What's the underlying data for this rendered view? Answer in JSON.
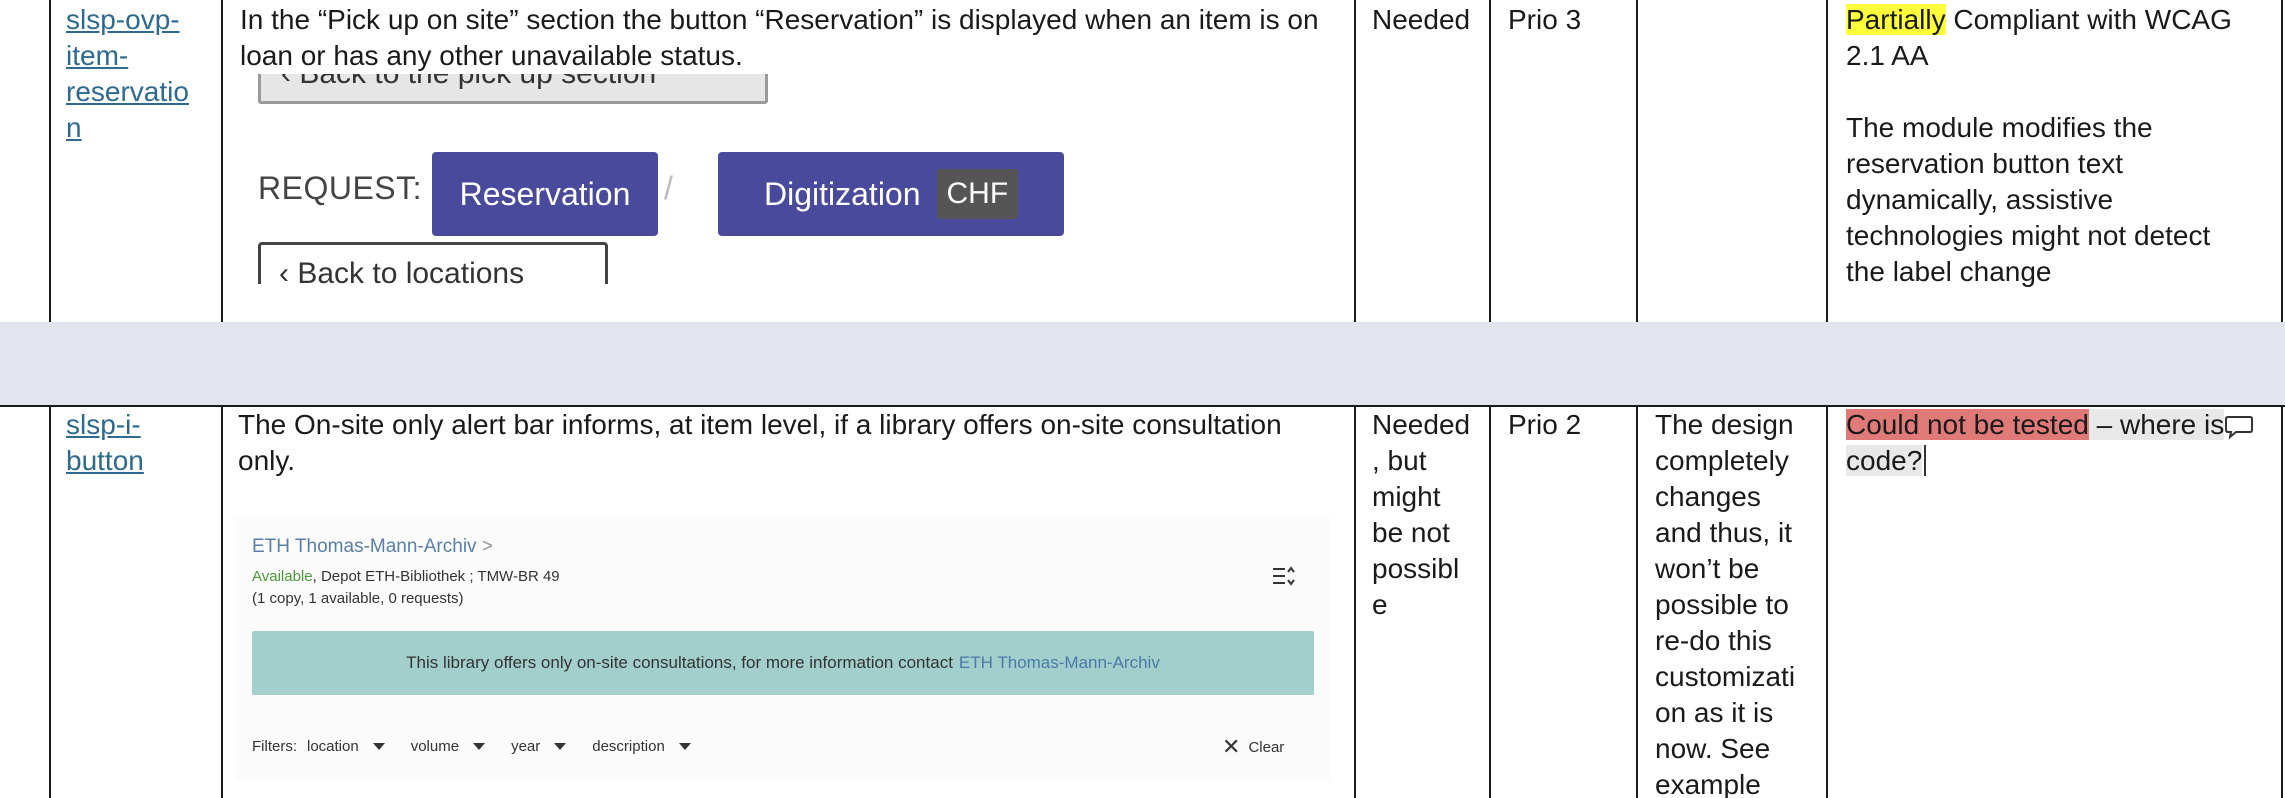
{
  "rows": [
    {
      "id_link": [
        "slsp-ovp-",
        "item-",
        "reservatio",
        "n"
      ],
      "description": [
        "In the “Pick up on site” section the button “Reservation” is displayed when an item is on",
        "loan or has any other unavailable status."
      ],
      "needed": [
        "Needed"
      ],
      "priority": "Prio 3",
      "notes": [],
      "compliance_highlight": "Partially",
      "compliance_rest_line1": " Compliant with WCAG",
      "compliance_line2": "2.1 AA",
      "compliance_detail": [
        "The module modifies the",
        "reservation button text",
        "dynamically, assistive",
        "technologies might not detect",
        "the label change"
      ],
      "screenshot": {
        "back_top_label": "Back to the pick up section",
        "request_label": "REQUEST:",
        "reservation_label": "Reservation",
        "separator": "/",
        "digitization_label": "Digitization",
        "chf_label": "CHF",
        "back_bottom_label": "Back to locations"
      }
    },
    {
      "id_link": [
        "slsp-i-",
        "button"
      ],
      "description": [
        "The On-site only alert bar informs, at item level, if a library offers on-site consultation",
        "only."
      ],
      "needed": [
        "Needed",
        ", but",
        "might",
        "be not",
        "possibl",
        "e"
      ],
      "priority": "Prio 2",
      "notes": [
        "The design",
        "completely",
        "changes",
        "and thus, it",
        "won’t be",
        "possible to",
        "re-do this",
        "customizati",
        "on as it is",
        "now. See",
        "example"
      ],
      "compliance_highlight": "Could not be tested",
      "compliance_rest_line1": " – where is",
      "compliance_line2": "code?",
      "screenshot": {
        "library_link": "ETH Thomas-Mann-Archiv",
        "library_chevron": ">",
        "available_label": "Available",
        "location_text": ", Depot ETH-Bibliothek ; TMW-BR 49",
        "copies_text": "(1 copy, 1 available, 0 requests)",
        "alert_text": "This library offers only on-site consultations, for more information contact",
        "alert_link": "ETH Thomas-Mann-Archiv",
        "filters_label": "Filters:",
        "filter_options": [
          "location",
          "volume",
          "year",
          "description"
        ],
        "clear_label": "Clear"
      }
    }
  ],
  "colors": {
    "link": "#2d6a8f",
    "highlight_yellow": "#ffff3b",
    "highlight_red": "#e07a78",
    "row_gap": "#e2e4f0",
    "button": "#4a4a9c",
    "alert_bar": "#a2cfcc"
  },
  "icons": [
    "comment-icon",
    "sort-icon",
    "close-icon",
    "chevron-right-icon",
    "caret-down-icon",
    "back-arrow-icon"
  ]
}
